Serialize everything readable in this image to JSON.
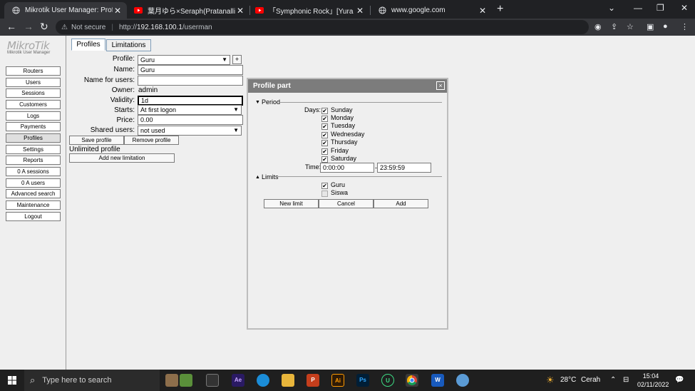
{
  "browser": {
    "tabs": [
      {
        "title": "Mikrotik User Manager: Profiles",
        "icon": "globe-icon",
        "active": true
      },
      {
        "title": "葉月ゆら×Seraph(Pratanallis) - YU",
        "icon": "youtube-icon",
        "active": false
      },
      {
        "title": "「Symphonic Rock」[Yura Hatsuki",
        "icon": "youtube-icon",
        "active": false
      },
      {
        "title": "www.google.com",
        "icon": "globe-icon",
        "active": false
      }
    ],
    "security": "Not secure",
    "url_scheme": "http://",
    "url_host": "192.168.100.1",
    "url_path": "/userman"
  },
  "app": {
    "logo_text": "MikroTik",
    "logo_sub": "Mikrotik User Manager",
    "nav": [
      {
        "label": "Routers"
      },
      {
        "label": "Users"
      },
      {
        "label": "Sessions"
      },
      {
        "label": "Customers"
      },
      {
        "label": "Logs"
      },
      {
        "label": "Payments"
      },
      {
        "label": "Profiles",
        "active": true
      },
      {
        "label": "Settings"
      },
      {
        "label": "Reports"
      },
      {
        "label": "0 A sessions"
      },
      {
        "label": "0 A users"
      },
      {
        "label": "Advanced search"
      },
      {
        "label": "Maintenance"
      },
      {
        "label": "Logout"
      }
    ],
    "tabs": [
      "Profiles",
      "Limitations"
    ]
  },
  "form": {
    "profile_label": "Profile:",
    "profile_value": "Guru",
    "plus": "+",
    "name_label": "Name:",
    "name_value": "Guru",
    "name_for_users_label": "Name for users:",
    "name_for_users_value": "",
    "owner_label": "Owner:",
    "owner_value": "admin",
    "validity_label": "Validity:",
    "validity_value": "1d",
    "starts_label": "Starts:",
    "starts_value": "At first logon",
    "price_label": "Price:",
    "price_value": "0.00",
    "shared_label": "Shared users:",
    "shared_value": "not used",
    "save_btn": "Save profile",
    "remove_btn": "Remove profile",
    "unlimited_text": "Unlimited profile",
    "add_limitation_btn": "Add new limitation"
  },
  "dialog": {
    "title": "Profile part",
    "close": "×",
    "period_label": "Period",
    "days_label": "Days:",
    "days": [
      {
        "label": "Sunday",
        "checked": true
      },
      {
        "label": "Monday",
        "checked": true
      },
      {
        "label": "Tuesday",
        "checked": true
      },
      {
        "label": "Wednesday",
        "checked": true
      },
      {
        "label": "Thursday",
        "checked": true
      },
      {
        "label": "Friday",
        "checked": true
      },
      {
        "label": "Saturday",
        "checked": true
      }
    ],
    "time_label": "Time:",
    "time_from": "0:00:00",
    "time_dash": "-",
    "time_to": "23:59:59",
    "limits_label": "Limits",
    "limits": [
      {
        "label": "Guru",
        "checked": true
      },
      {
        "label": "Siswa",
        "checked": false
      }
    ],
    "new_limit_btn": "New limit",
    "cancel_btn": "Cancel",
    "add_btn": "Add"
  },
  "taskbar": {
    "search_placeholder": "Type here to search",
    "weather": "28°C",
    "weather_text": "Cerah",
    "time": "15:04",
    "date": "02/11/2022"
  },
  "colors": {
    "chrome_dark": "#202124",
    "chrome_toolbar": "#35363a",
    "dialog_title": "#7c7c7c",
    "page_bg": "#efefef"
  }
}
